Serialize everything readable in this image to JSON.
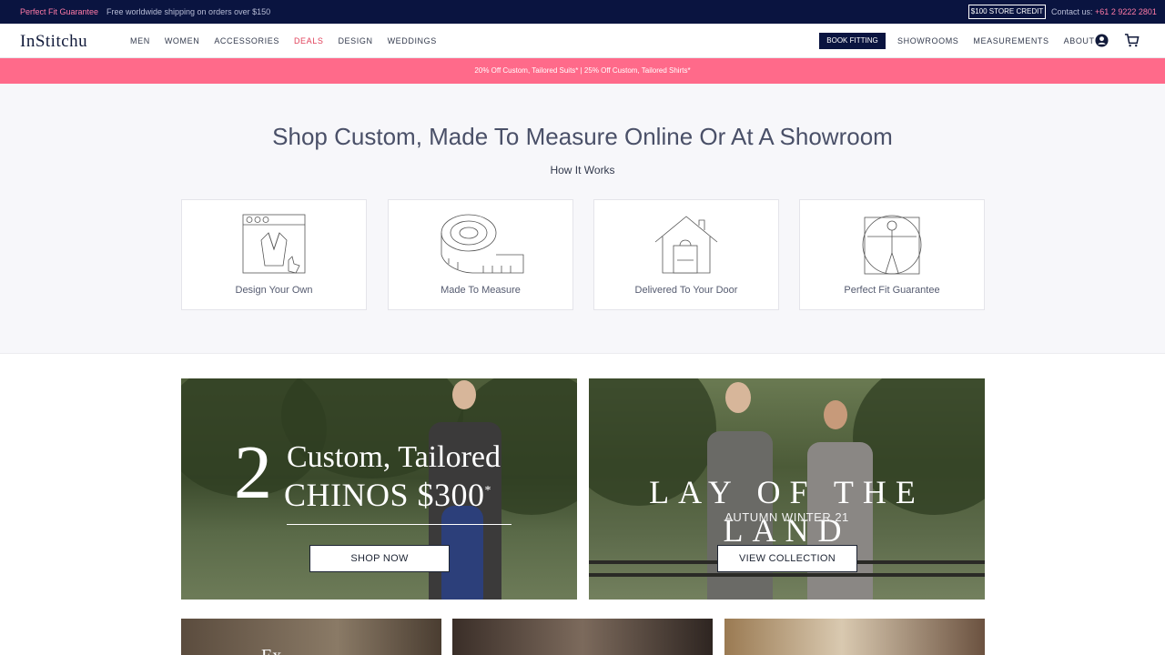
{
  "topbar": {
    "perfect_fit": "Perfect Fit Guarantee",
    "shipping": "Free worldwide shipping on orders over $150",
    "store_credit": "$100 STORE CREDIT",
    "contact_label": "Contact us:",
    "phone": "+61 2 9222 2801"
  },
  "nav": {
    "logo": "InStitchu",
    "links": [
      "MEN",
      "WOMEN",
      "ACCESSORIES",
      "DEALS",
      "DESIGN",
      "WEDDINGS"
    ],
    "book_fitting": "BOOK FITTING",
    "right_links": [
      "SHOWROOMS",
      "MEASUREMENTS",
      "ABOUT"
    ],
    "user_icon": "user-icon",
    "cart_icon": "cart-icon"
  },
  "promo": "20% Off Custom, Tailored Suits* | 25% Off Custom, Tailored Shirts*",
  "how": {
    "title": "Shop Custom, Made To Measure Online Or At A Showroom",
    "subtitle": "How It Works",
    "steps": [
      {
        "label": "Design Your Own",
        "icon": "browser-jacket-icon"
      },
      {
        "label": "Made To Measure",
        "icon": "measuring-tape-icon"
      },
      {
        "label": "Delivered To Your Door",
        "icon": "house-bag-icon"
      },
      {
        "label": "Perfect Fit Guarantee",
        "icon": "vitruvian-man-icon"
      }
    ]
  },
  "banners": [
    {
      "number": "2",
      "line1": "Custom, Tailored",
      "line2": "CHINOS $300",
      "asterisk": "*",
      "button": "SHOP NOW"
    },
    {
      "title": "LAY OF THE LAND",
      "subtitle": "AUTUMN WINTER 21",
      "button": "VIEW COLLECTION"
    }
  ],
  "tiles": {
    "tile1_text": "Ex"
  },
  "colors": {
    "navy": "#0a1440",
    "pink": "#ff6a8a",
    "deals": "#e0405a"
  }
}
